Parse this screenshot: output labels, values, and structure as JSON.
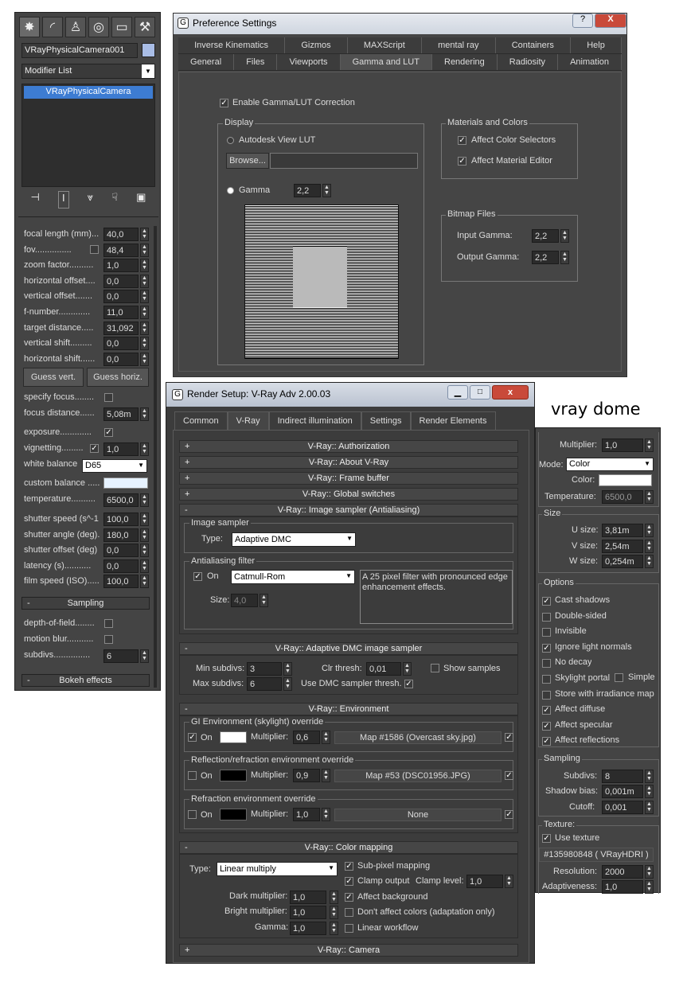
{
  "left": {
    "object_name": "VRayPhysicalCamera001",
    "modifier_list": "Modifier List",
    "stack_item": "VRayPhysicalCamera",
    "rows": [
      {
        "label": "focal length (mm)...",
        "value": "40,0"
      },
      {
        "label": "fov...............",
        "value": "48,4"
      },
      {
        "label": "zoom factor..........",
        "value": "1,0"
      },
      {
        "label": "horizontal offset....",
        "value": "0,0"
      },
      {
        "label": "vertical offset.......",
        "value": "0,0"
      },
      {
        "label": "f-number.............",
        "value": "11,0"
      },
      {
        "label": "target distance.....",
        "value": "31,092"
      },
      {
        "label": "vertical shift.........",
        "value": "0,0"
      },
      {
        "label": "horizontal shift......",
        "value": "0,0"
      }
    ],
    "guess_vert": "Guess vert.",
    "guess_horiz": "Guess horiz.",
    "specify_focus": "specify focus........",
    "focus_distance_label": "focus distance......",
    "focus_distance": "5,08m",
    "exposure": "exposure.............",
    "vignetting": "vignetting.........",
    "vignetting_value": "1,0",
    "white_balance": "white balance",
    "white_balance_value": "D65",
    "custom_balance": "custom balance .....",
    "temperature_label": "temperature..........",
    "temperature": "6500,0",
    "rows2": [
      {
        "label": "shutter speed (s^-1",
        "value": "100,0"
      },
      {
        "label": "shutter angle (deg).",
        "value": "180,0"
      },
      {
        "label": "shutter offset (deg)",
        "value": "0,0"
      },
      {
        "label": "latency (s)...........",
        "value": "0,0"
      },
      {
        "label": "film speed (ISO).....",
        "value": "100,0"
      }
    ],
    "sampling": "Sampling",
    "dof": "depth-of-field........",
    "motion_blur": "motion blur...........",
    "subdivs_label": "subdivs...............",
    "subdivs": "6",
    "bokeh": "Bokeh effects",
    "minus": "-"
  },
  "pref": {
    "title": "Preference Settings",
    "help_btn": "?",
    "close_btn": "X",
    "tabs_top": [
      "Inverse Kinematics",
      "Gizmos",
      "MAXScript",
      "mental ray",
      "Containers",
      "Help"
    ],
    "tabs_bottom": [
      "General",
      "Files",
      "Viewports",
      "Gamma and LUT",
      "Rendering",
      "Radiosity",
      "Animation"
    ],
    "enable": "Enable Gamma/LUT Correction",
    "display": "Display",
    "autodesk_lut": "Autodesk View LUT",
    "browse": "Browse...",
    "gamma": "Gamma",
    "gamma_value": "2,2",
    "materials": "Materials and Colors",
    "affect_color": "Affect Color Selectors",
    "affect_material": "Affect Material Editor",
    "bitmap": "Bitmap Files",
    "input_gamma": "Input Gamma:",
    "input_value": "2,2",
    "output_gamma": "Output Gamma:",
    "output_value": "2,2"
  },
  "rs": {
    "title": "Render Setup: V-Ray Adv 2.00.03",
    "tabs": [
      "Common",
      "V-Ray",
      "Indirect illumination",
      "Settings",
      "Render Elements"
    ],
    "plus": "+",
    "minus": "-",
    "r_auth": "V-Ray:: Authorization",
    "r_about": "V-Ray:: About V-Ray",
    "r_frame": "V-Ray:: Frame buffer",
    "r_global": "V-Ray:: Global switches",
    "r_sampler": "V-Ray:: Image sampler (Antialiasing)",
    "image_sampler": "Image sampler",
    "type": "Type:",
    "sampler_value": "Adaptive DMC",
    "aa_filter": "Antialiasing filter",
    "on": "On",
    "filter_value": "Catmull-Rom",
    "filter_desc": "A 25 pixel filter with pronounced edge enhancement effects.",
    "size": "Size:",
    "size_value": "4,0",
    "r_adaptive": "V-Ray:: Adaptive DMC image sampler",
    "min_subdivs": "Min subdivs:",
    "min_value": "3",
    "clr_thresh": "Clr thresh:",
    "clr_value": "0,01",
    "show_samples": "Show samples",
    "max_subdivs": "Max subdivs:",
    "max_value": "6",
    "use_dmc": "Use DMC sampler thresh.",
    "r_env": "V-Ray:: Environment",
    "gi_env": "GI Environment (skylight) override",
    "multiplier": "Multiplier:",
    "gi_mult": "0,6",
    "gi_map": "Map #1586 (Overcast sky.jpg)",
    "refl_env": "Reflection/refraction environment override",
    "refl_mult": "0,9",
    "refl_map": "Map #53 (DSC01956.JPG)",
    "refr_env": "Refraction environment override",
    "refr_mult": "1,0",
    "refr_map": "None",
    "r_color": "V-Ray:: Color mapping",
    "cm_type_value": "Linear multiply",
    "subpixel": "Sub-pixel mapping",
    "clamp_output": "Clamp output",
    "clamp_level": "Clamp level:",
    "clamp_value": "1,0",
    "dark_mult": "Dark multiplier:",
    "dark_value": "1,0",
    "affect_bg": "Affect background",
    "bright_mult": "Bright multiplier:",
    "bright_value": "1,0",
    "dont_affect": "Don't affect colors (adaptation only)",
    "gamma": "Gamma:",
    "gamma_value": "1,0",
    "linear": "Linear workflow",
    "r_camera": "V-Ray:: Camera"
  },
  "dome": {
    "caption": "vray dome",
    "multiplier": "Multiplier:",
    "mult_value": "1,0",
    "mode": "Mode:",
    "mode_value": "Color",
    "color": "Color:",
    "temperature": "Temperature:",
    "temp_value": "6500,0",
    "size": "Size",
    "u": "U size:",
    "u_value": "3,81m",
    "v": "V size:",
    "v_value": "2,54m",
    "w": "W size:",
    "w_value": "0,254m",
    "options": "Options",
    "opts": [
      {
        "label": "Cast shadows",
        "checked": true
      },
      {
        "label": "Double-sided",
        "checked": false
      },
      {
        "label": "Invisible",
        "checked": false
      },
      {
        "label": "Ignore light normals",
        "checked": true
      },
      {
        "label": "No decay",
        "checked": false
      },
      {
        "label": "Skylight portal",
        "checked": false
      },
      {
        "label": "Store with irradiance map",
        "checked": false
      },
      {
        "label": "Affect diffuse",
        "checked": true
      },
      {
        "label": "Affect specular",
        "checked": true
      },
      {
        "label": "Affect reflections",
        "checked": true
      }
    ],
    "simple": "Simple",
    "sampling": "Sampling",
    "subdivs": "Subdivs:",
    "subdivs_value": "8",
    "shadow_bias": "Shadow bias:",
    "bias_value": "0,001m",
    "cutoff": "Cutoff:",
    "cutoff_value": "0,001",
    "texture": "Texture:",
    "use_texture": "Use texture",
    "tex_map": "#135980848 ( VRayHDRI )",
    "resolution": "Resolution:",
    "res_value": "2000",
    "adaptiveness": "Adaptiveness:",
    "adapt_value": "1,0"
  }
}
